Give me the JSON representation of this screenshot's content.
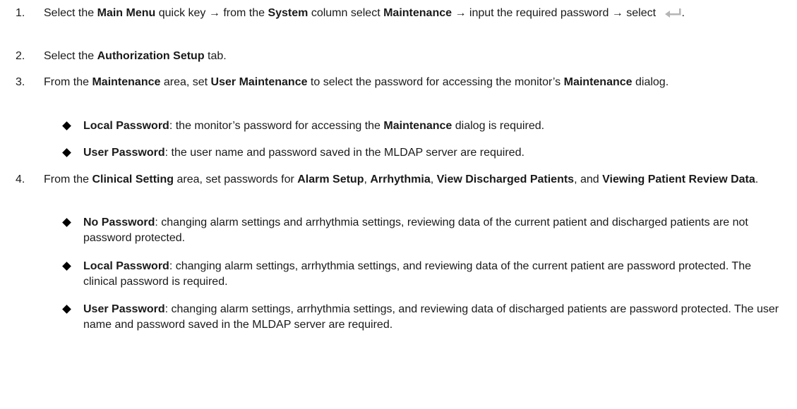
{
  "steps": [
    {
      "num": "1.",
      "parts": [
        {
          "t": "Select the ",
          "b": false
        },
        {
          "t": "Main Menu",
          "b": true
        },
        {
          "t": " quick key → from the ",
          "b": false
        },
        {
          "t": "System",
          "b": true
        },
        {
          "t": " column select ",
          "b": false
        },
        {
          "t": "Maintenance",
          "b": true
        },
        {
          "t": " → input the required password → select ",
          "b": false
        }
      ],
      "tail": "."
    },
    {
      "num": "2.",
      "parts": [
        {
          "t": "Select the ",
          "b": false
        },
        {
          "t": "Authorization Setup",
          "b": true
        },
        {
          "t": " tab.",
          "b": false
        }
      ]
    },
    {
      "num": "3.",
      "parts": [
        {
          "t": "From the ",
          "b": false
        },
        {
          "t": "Maintenance",
          "b": true
        },
        {
          "t": " area, set ",
          "b": false
        },
        {
          "t": "User Maintenance",
          "b": true
        },
        {
          "t": " to select the password for accessing the monitor’s ",
          "b": false
        },
        {
          "t": "Maintenance",
          "b": true
        },
        {
          "t": " dialog.",
          "b": false
        }
      ]
    },
    {
      "num": "4.",
      "parts": [
        {
          "t": "From the ",
          "b": false
        },
        {
          "t": "Clinical Setting",
          "b": true
        },
        {
          "t": " area, set passwords for ",
          "b": false
        },
        {
          "t": "Alarm Setup",
          "b": true
        },
        {
          "t": ", ",
          "b": false
        },
        {
          "t": "Arrhythmia",
          "b": true
        },
        {
          "t": ", ",
          "b": false
        },
        {
          "t": "View Discharged Patients",
          "b": true
        },
        {
          "t": ", and ",
          "b": false
        },
        {
          "t": "Viewing Patient Review Data",
          "b": true
        },
        {
          "t": ".",
          "b": false
        }
      ]
    }
  ],
  "bullets": [
    {
      "parts": [
        {
          "t": "Local Password",
          "b": true
        },
        {
          "t": ": the monitor’s password for accessing the ",
          "b": false
        },
        {
          "t": "Maintenance",
          "b": true
        },
        {
          "t": " dialog is required.",
          "b": false
        }
      ]
    },
    {
      "parts": [
        {
          "t": "User Password",
          "b": true
        },
        {
          "t": ": the user name and password saved in the MLDAP server are required.",
          "b": false
        }
      ]
    },
    {
      "parts": [
        {
          "t": "No Password",
          "b": true
        },
        {
          "t": ": changing alarm settings and arrhythmia settings, reviewing data of the current patient and discharged patients are not password protected.",
          "b": false
        }
      ]
    },
    {
      "parts": [
        {
          "t": "Local Password",
          "b": true
        },
        {
          "t": ": changing alarm settings, arrhythmia settings, and reviewing data of the current patient are password protected. The clinical password is required.",
          "b": false
        }
      ]
    },
    {
      "parts": [
        {
          "t": "User Password",
          "b": true
        },
        {
          "t": ": changing alarm settings, arrhythmia settings, and reviewing data of discharged patients are password protected. The user name and password saved in the MLDAP server are required.",
          "b": false
        }
      ]
    }
  ],
  "icons": {
    "enter": "enter-key-icon",
    "bullet": "diamond-bullet-icon",
    "icon_color": "#b5b5b5"
  }
}
